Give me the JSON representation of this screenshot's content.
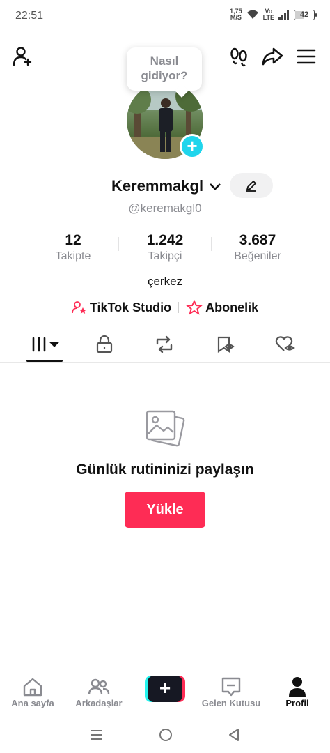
{
  "status_bar": {
    "time": "22:51",
    "net_speed_value": "1,75",
    "net_speed_unit": "M/S",
    "volte_top": "Vo",
    "volte_bottom": "LTE",
    "battery": "42"
  },
  "bubble": {
    "line1": "Nasıl",
    "line2": "gidiyor?"
  },
  "profile": {
    "username": "Keremmakgl",
    "handle": "@keremakgl0",
    "bio": "çerkez"
  },
  "stats": [
    {
      "value": "12",
      "label": "Takipte"
    },
    {
      "value": "1.242",
      "label": "Takipçi"
    },
    {
      "value": "3.687",
      "label": "Beğeniler"
    }
  ],
  "links": {
    "studio": "TikTok Studio",
    "subscription": "Abonelik"
  },
  "empty_state": {
    "title": "Günlük rutininizi paylaşın",
    "button": "Yükle"
  },
  "bottom_nav": [
    {
      "label": "Ana sayfa",
      "icon": "home-icon"
    },
    {
      "label": "Arkadaşlar",
      "icon": "friends-icon"
    },
    {
      "label": "",
      "icon": "plus-icon"
    },
    {
      "label": "Gelen Kutusu",
      "icon": "inbox-icon"
    },
    {
      "label": "Profil",
      "icon": "profile-icon"
    }
  ],
  "colors": {
    "accent": "#fe2c55",
    "cyan": "#20d5ec",
    "text_primary": "#111111",
    "text_secondary": "#8a8b91"
  }
}
